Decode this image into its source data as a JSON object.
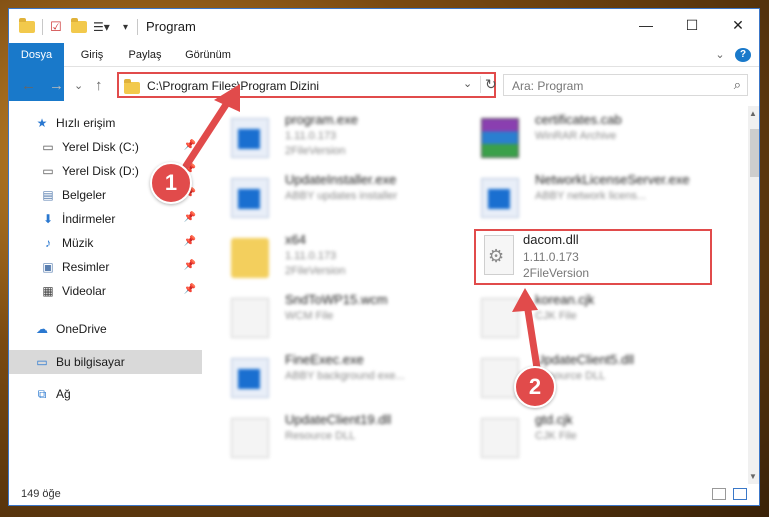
{
  "window": {
    "title": "Program",
    "controls": {
      "minimize": "—",
      "maximize": "☐",
      "close": "✕"
    }
  },
  "ribbon": {
    "tabs": [
      "Dosya",
      "Giriş",
      "Paylaş",
      "Görünüm"
    ],
    "expand_icon": "chevron-down-icon",
    "help_label": "?"
  },
  "address": {
    "path": "C:\\Program Files\\Program Dizini",
    "chevron": "⌄",
    "refresh": "↻"
  },
  "search": {
    "placeholder": "Ara: Program",
    "icon": "search-icon"
  },
  "nav": {
    "back": "←",
    "forward": "→",
    "recent": "⌄",
    "up": "↑",
    "items": [
      {
        "label": "Hızlı erişim",
        "icon": "star-icon",
        "pinned": false
      },
      {
        "label": "Yerel Disk (C:)",
        "icon": "drive-icon",
        "pinned": true
      },
      {
        "label": "Yerel Disk (D:)",
        "icon": "drive-icon",
        "pinned": true
      },
      {
        "label": "Belgeler",
        "icon": "documents-icon",
        "pinned": true
      },
      {
        "label": "İndirmeler",
        "icon": "download-icon",
        "pinned": true
      },
      {
        "label": "Müzik",
        "icon": "music-icon",
        "pinned": true
      },
      {
        "label": "Resimler",
        "icon": "pictures-icon",
        "pinned": true
      },
      {
        "label": "Videolar",
        "icon": "video-icon",
        "pinned": true
      },
      {
        "label": "OneDrive",
        "icon": "cloud-icon",
        "pinned": false
      },
      {
        "label": "Bu bilgisayar",
        "icon": "computer-icon",
        "pinned": false,
        "selected": true
      },
      {
        "label": "Ağ",
        "icon": "network-icon",
        "pinned": false
      }
    ]
  },
  "files": [
    {
      "name": "program.exe",
      "line1": "1.11.0.173",
      "line2": "2FileVersion",
      "icon": "exe-icon"
    },
    {
      "name": "certificates.cab",
      "line1": "WinRAR Archive",
      "line2": "",
      "icon": "rar-icon"
    },
    {
      "name": "UpdateInstaller.exe",
      "line1": "ABBY updates installer",
      "line2": "",
      "icon": "exe-icon"
    },
    {
      "name": "NetworkLicenseServer.exe",
      "line1": "ABBY network licens...",
      "line2": "",
      "icon": "exe-icon"
    },
    {
      "name": "x64",
      "line1": "1.11.0.173",
      "line2": "2FileVersion",
      "icon": "folder-icon"
    },
    {
      "name": "SndToWP15.wcm",
      "line1": "WCM File",
      "line2": "",
      "icon": "document-icon"
    },
    {
      "name": "korean.cjk",
      "line1": "CJK File",
      "line2": "",
      "icon": "document-icon"
    },
    {
      "name": "FineExec.exe",
      "line1": "ABBY background exe...",
      "line2": "",
      "icon": "exe-icon"
    },
    {
      "name": "UpdateClient5.dll",
      "line1": "Resource DLL",
      "line2": "",
      "icon": "gear-icon"
    },
    {
      "name": "UpdateClient19.dll",
      "line1": "Resource DLL",
      "line2": "",
      "icon": "gear-icon"
    },
    {
      "name": "gtd.cjk",
      "line1": "CJK File",
      "line2": "",
      "icon": "document-icon"
    }
  ],
  "highlighted_file": {
    "name": "dacom.dll",
    "version": "1.11.0.173",
    "type": "2FileVersion",
    "icon": "dll-gear-icon"
  },
  "annotations": {
    "step1": "1",
    "step2": "2",
    "color": "#e14b4b"
  },
  "status": {
    "count": "149 öğe"
  },
  "colors": {
    "accent": "#1979ca",
    "highlight": "#e14b4b",
    "selected_nav": "#d9d9d9"
  }
}
